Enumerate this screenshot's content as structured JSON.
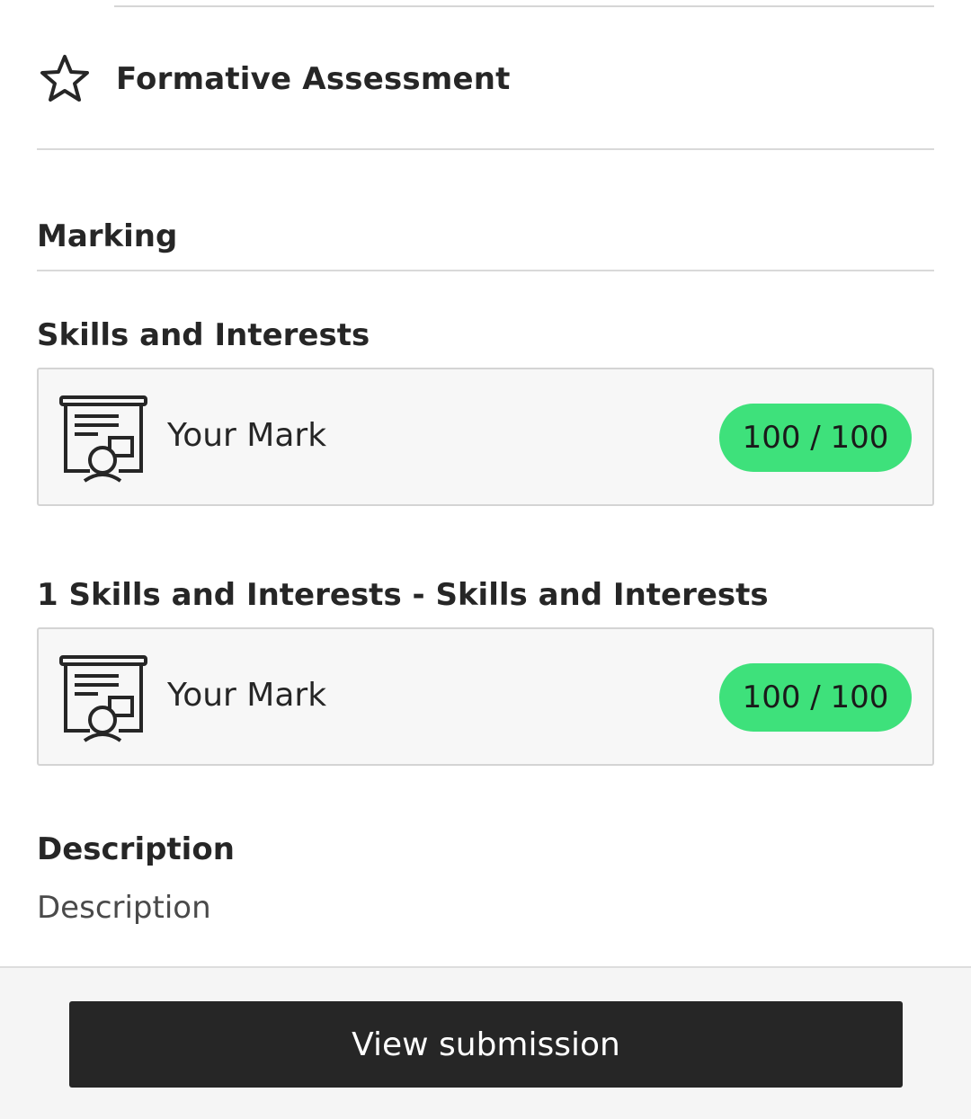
{
  "assessment": {
    "title": "Formative Assessment",
    "icon": "star-icon"
  },
  "marking": {
    "heading": "Marking"
  },
  "sections": [
    {
      "heading": "Skills and Interests",
      "mark_label": "Your Mark",
      "mark_value": "100 / 100",
      "icon": "presentation-icon"
    },
    {
      "heading": "1 Skills and Interests - Skills and Interests",
      "mark_label": "Your Mark",
      "mark_value": "100 / 100",
      "icon": "presentation-icon"
    }
  ],
  "description": {
    "heading": "Description",
    "text": "Description"
  },
  "footer": {
    "button_label": "View submission"
  },
  "colors": {
    "badge": "#3ee17b",
    "button": "#262626",
    "card_background": "#f7f7f7"
  }
}
